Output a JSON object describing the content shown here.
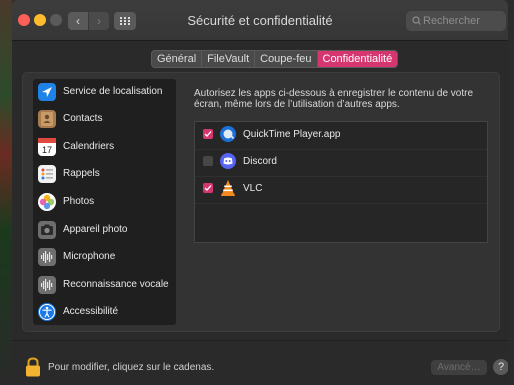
{
  "window": {
    "title": "Sécurité et confidentialité",
    "back_glyph": "‹",
    "forward_glyph": "›"
  },
  "search": {
    "placeholder": "Rechercher",
    "icon": "search-icon"
  },
  "tabs": [
    {
      "label": "Général",
      "active": false
    },
    {
      "label": "FileVault",
      "active": false
    },
    {
      "label": "Coupe-feu",
      "active": false
    },
    {
      "label": "Confidentialité",
      "active": true
    }
  ],
  "sidebar": {
    "items": [
      {
        "label": "Service de localisation",
        "icon": "location-icon"
      },
      {
        "label": "Contacts",
        "icon": "contacts-icon"
      },
      {
        "label": "Calendriers",
        "icon": "calendar-icon",
        "icon_text": "17"
      },
      {
        "label": "Rappels",
        "icon": "reminders-icon"
      },
      {
        "label": "Photos",
        "icon": "photos-icon"
      },
      {
        "label": "Appareil photo",
        "icon": "camera-icon"
      },
      {
        "label": "Microphone",
        "icon": "microphone-icon"
      },
      {
        "label": "Reconnaissance vocale",
        "icon": "speech-recognition-icon"
      },
      {
        "label": "Accessibilité",
        "icon": "accessibility-icon"
      }
    ]
  },
  "main": {
    "description": "Autorisez les apps ci-dessous à enregistrer le contenu de votre écran, même lors de l’utilisation d’autres apps.",
    "apps": [
      {
        "name": "QuickTime Player.app",
        "checked": true,
        "icon": "quicktime-icon"
      },
      {
        "name": "Discord",
        "checked": false,
        "icon": "discord-icon"
      },
      {
        "name": "VLC",
        "checked": true,
        "icon": "vlc-icon"
      }
    ]
  },
  "footer": {
    "lock_message": "Pour modifier, cliquez sur le cadenas.",
    "advanced_label": "Avancé…",
    "help_label": "?"
  },
  "colors": {
    "accent": "#d6366f",
    "window_bg": "#2a2a2a",
    "sidebar_bg": "#1f1f1f"
  }
}
